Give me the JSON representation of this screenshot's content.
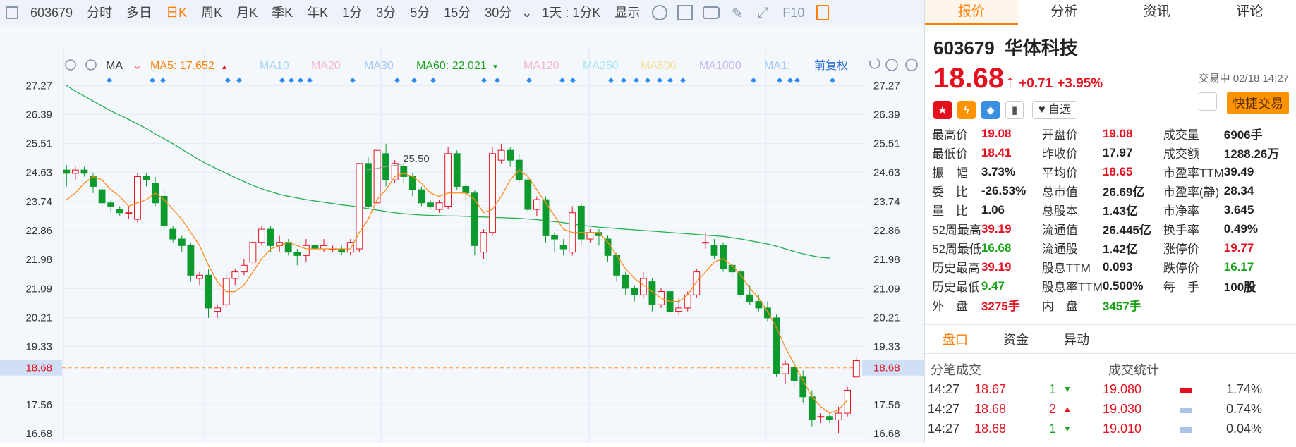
{
  "toolbar": {
    "code": "603679",
    "items": [
      "分时",
      "多日",
      "日K",
      "周K",
      "月K",
      "季K",
      "年K",
      "1分",
      "3分",
      "5分",
      "15分",
      "30分"
    ],
    "active": "日K",
    "range": "1天 : 1分K",
    "display": "显示",
    "f10": "F10"
  },
  "ma_bar": {
    "ma_label": "MA",
    "ma5": "MA5: 17.652",
    "ma10": "MA10",
    "ma20": "MA20",
    "ma30": "MA30",
    "ma60": "MA60: 22.021",
    "ma120": "MA120",
    "ma250": "MA250",
    "ma500": "MA500",
    "ma1000": "MA1000",
    "ma1": "MA1:",
    "adjust": "前复权"
  },
  "axis": {
    "ticks": [
      "27.27",
      "26.39",
      "25.51",
      "24.63",
      "23.74",
      "22.86",
      "21.98",
      "21.09",
      "20.21",
      "19.33",
      "18.68",
      "17.56",
      "16.68"
    ],
    "current": "18.68"
  },
  "annotations": {
    "high": "25.50",
    "low": "16.68"
  },
  "right": {
    "tabs": [
      "报价",
      "分析",
      "资讯",
      "评论"
    ],
    "code": "603679",
    "name": "华体科技",
    "price": "18.68",
    "arrow": "↑",
    "change": "+0.71",
    "pct": "+3.95%",
    "status": "交易中 02/18 14:27",
    "fav": "自选",
    "quick": "快捷交易",
    "quotes": [
      [
        "最高价",
        "19.08",
        "red",
        "开盘价",
        "19.08",
        "red",
        "成交量",
        "6906手",
        "blk"
      ],
      [
        "最低价",
        "18.41",
        "red",
        "昨收价",
        "17.97",
        "blk",
        "成交额",
        "1288.26万",
        "blk"
      ],
      [
        "振　幅",
        "3.73%",
        "blk",
        "平均价",
        "18.65",
        "red",
        "市盈率TTM",
        "39.49",
        "blk"
      ],
      [
        "委　比",
        "-26.53%",
        "blk",
        "总市值",
        "26.69亿",
        "blk",
        "市盈率(静)",
        "28.34",
        "blk"
      ],
      [
        "量　比",
        "1.06",
        "blk",
        "总股本",
        "1.43亿",
        "blk",
        "市净率",
        "3.645",
        "blk"
      ],
      [
        "52周最高",
        "39.19",
        "red",
        "流通值",
        "26.445亿",
        "blk",
        "换手率",
        "0.49%",
        "blk"
      ],
      [
        "52周最低",
        "16.68",
        "grn",
        "流通股",
        "1.42亿",
        "blk",
        "涨停价",
        "19.77",
        "red"
      ],
      [
        "历史最高",
        "39.19",
        "red",
        "股息TTM",
        "0.093",
        "blk",
        "跌停价",
        "16.17",
        "grn"
      ],
      [
        "历史最低",
        "9.47",
        "grn",
        "股息率TTM",
        "0.500%",
        "blk",
        "每　手",
        "100股",
        "blk"
      ],
      [
        "外　盘",
        "3275手",
        "red",
        "内　盘",
        "3457手",
        "grn",
        "",
        "",
        ""
      ]
    ],
    "ptabs": [
      "盘口",
      "资金",
      "异动"
    ],
    "ticks_header": "分笔成交",
    "stats_header": "成交统计",
    "ticks": [
      {
        "t": "14:27",
        "p": "18.67",
        "v": "1",
        "d": "down",
        "sp": "19.080",
        "pct": "1.74%"
      },
      {
        "t": "14:27",
        "p": "18.68",
        "v": "2",
        "d": "up",
        "sp": "19.030",
        "pct": "0.74%"
      },
      {
        "t": "14:27",
        "p": "18.68",
        "v": "1",
        "d": "down",
        "sp": "19.010",
        "pct": "0.04%"
      }
    ]
  },
  "chart_data": {
    "type": "candlestick",
    "ylim": [
      16.4,
      27.6
    ],
    "candles": [
      [
        24.7,
        24.6,
        24.85,
        24.2
      ],
      [
        24.6,
        24.7,
        24.8,
        24.4
      ],
      [
        24.7,
        24.6,
        24.8,
        24.5
      ],
      [
        24.5,
        24.2,
        24.6,
        24.0
      ],
      [
        24.1,
        23.7,
        24.2,
        23.6
      ],
      [
        23.7,
        23.6,
        23.8,
        23.4
      ],
      [
        23.5,
        23.4,
        23.6,
        23.3
      ],
      [
        23.4,
        23.4,
        23.6,
        23.2
      ],
      [
        23.2,
        24.5,
        24.6,
        23.1
      ],
      [
        24.5,
        24.4,
        24.6,
        24.2
      ],
      [
        24.3,
        23.7,
        24.5,
        23.6
      ],
      [
        23.9,
        23.0,
        24.1,
        22.9
      ],
      [
        22.9,
        22.6,
        23.0,
        22.5
      ],
      [
        22.6,
        22.4,
        22.7,
        22.2
      ],
      [
        22.4,
        21.5,
        22.5,
        21.3
      ],
      [
        21.4,
        21.5,
        21.6,
        21.2
      ],
      [
        21.5,
        20.5,
        21.7,
        20.2
      ],
      [
        20.4,
        20.5,
        20.6,
        20.2
      ],
      [
        20.6,
        21.4,
        21.5,
        20.5
      ],
      [
        21.4,
        21.6,
        21.7,
        21.2
      ],
      [
        21.6,
        21.8,
        22.0,
        21.5
      ],
      [
        21.9,
        22.5,
        22.7,
        21.8
      ],
      [
        22.5,
        22.9,
        23.0,
        22.4
      ],
      [
        22.9,
        22.4,
        23.0,
        22.2
      ],
      [
        22.4,
        22.5,
        22.7,
        22.2
      ],
      [
        22.5,
        22.2,
        22.6,
        22.1
      ],
      [
        22.2,
        22.1,
        22.3,
        21.8
      ],
      [
        22.1,
        22.4,
        22.6,
        21.9
      ],
      [
        22.4,
        22.3,
        22.5,
        22.2
      ],
      [
        22.3,
        22.4,
        22.6,
        22.2
      ],
      [
        22.3,
        22.3,
        22.4,
        22.2
      ],
      [
        22.3,
        22.2,
        22.4,
        22.1
      ],
      [
        22.2,
        22.5,
        22.6,
        22.1
      ],
      [
        22.3,
        24.9,
        24.9,
        22.2
      ],
      [
        24.9,
        23.6,
        25.1,
        23.5
      ],
      [
        23.7,
        25.3,
        25.5,
        23.6
      ],
      [
        25.2,
        24.4,
        25.5,
        24.2
      ],
      [
        24.4,
        24.9,
        25.0,
        24.3
      ],
      [
        24.8,
        24.5,
        24.9,
        24.3
      ],
      [
        24.5,
        24.1,
        24.6,
        23.9
      ],
      [
        24.1,
        23.7,
        24.2,
        23.6
      ],
      [
        23.7,
        23.6,
        23.8,
        23.5
      ],
      [
        23.5,
        23.7,
        23.8,
        23.4
      ],
      [
        23.6,
        25.2,
        25.4,
        23.5
      ],
      [
        25.2,
        24.2,
        25.3,
        24.1
      ],
      [
        24.2,
        24.0,
        24.3,
        23.8
      ],
      [
        24.0,
        22.4,
        24.1,
        22.1
      ],
      [
        22.2,
        22.8,
        22.9,
        22.0
      ],
      [
        22.8,
        25.2,
        25.4,
        22.7
      ],
      [
        25.0,
        25.3,
        25.5,
        24.9
      ],
      [
        25.3,
        25.0,
        25.4,
        24.8
      ],
      [
        25.0,
        24.4,
        25.2,
        24.3
      ],
      [
        24.4,
        23.5,
        24.6,
        23.4
      ],
      [
        23.5,
        23.8,
        23.9,
        23.3
      ],
      [
        23.8,
        22.7,
        23.9,
        22.5
      ],
      [
        22.7,
        22.6,
        22.8,
        22.2
      ],
      [
        22.4,
        22.3,
        22.6,
        22.1
      ],
      [
        22.2,
        23.4,
        23.6,
        22.1
      ],
      [
        23.6,
        22.6,
        23.7,
        22.4
      ],
      [
        22.6,
        22.8,
        22.9,
        22.5
      ],
      [
        22.8,
        22.7,
        22.9,
        22.4
      ],
      [
        22.6,
        22.1,
        22.7,
        21.9
      ],
      [
        22.1,
        21.5,
        22.2,
        21.3
      ],
      [
        21.5,
        21.1,
        21.6,
        20.9
      ],
      [
        21.1,
        20.9,
        21.2,
        20.7
      ],
      [
        20.9,
        21.4,
        21.6,
        20.8
      ],
      [
        21.3,
        20.6,
        21.4,
        20.4
      ],
      [
        20.6,
        21.0,
        21.1,
        20.5
      ],
      [
        21.0,
        20.4,
        21.1,
        20.3
      ],
      [
        20.4,
        20.5,
        20.8,
        20.3
      ],
      [
        20.5,
        20.9,
        21.0,
        20.4
      ],
      [
        20.9,
        21.6,
        21.7,
        20.8
      ],
      [
        22.5,
        22.5,
        22.8,
        22.3
      ],
      [
        22.4,
        22.1,
        22.6,
        22.0
      ],
      [
        22.4,
        21.7,
        22.5,
        21.6
      ],
      [
        21.8,
        21.6,
        21.9,
        21.4
      ],
      [
        21.6,
        20.9,
        21.7,
        20.8
      ],
      [
        20.9,
        20.7,
        21.2,
        20.6
      ],
      [
        20.7,
        20.5,
        20.9,
        20.4
      ],
      [
        20.5,
        20.2,
        20.7,
        20.1
      ],
      [
        20.2,
        18.5,
        20.3,
        18.4
      ],
      [
        18.5,
        18.8,
        18.9,
        18.2
      ],
      [
        18.7,
        18.3,
        18.9,
        18.1
      ],
      [
        18.4,
        17.8,
        18.6,
        17.6
      ],
      [
        17.8,
        17.1,
        18.0,
        16.9
      ],
      [
        17.2,
        17.2,
        17.3,
        17.0
      ],
      [
        17.2,
        17.1,
        17.3,
        17.0
      ],
      [
        17.1,
        17.3,
        17.5,
        16.7
      ],
      [
        17.3,
        18.0,
        18.1,
        17.2
      ],
      [
        18.4,
        18.9,
        19.0,
        18.4
      ]
    ],
    "ma5": [
      23.8,
      24.0,
      24.3,
      24.5,
      24.4,
      24.1,
      23.9,
      23.6,
      23.7,
      23.8,
      24.0,
      23.8,
      23.5,
      23.2,
      22.8,
      22.4,
      21.8,
      21.3,
      21.0,
      21.0,
      21.2,
      21.6,
      22.0,
      22.3,
      22.4,
      22.5,
      22.4,
      22.3,
      22.3,
      22.3,
      22.3,
      22.3,
      22.3,
      22.8,
      23.2,
      23.8,
      24.1,
      24.5,
      24.6,
      24.5,
      24.3,
      24.0,
      23.9,
      24.0,
      24.0,
      24.0,
      23.8,
      23.4,
      23.5,
      23.9,
      24.4,
      24.7,
      24.5,
      24.1,
      23.7,
      23.3,
      22.9,
      22.8,
      22.8,
      22.8,
      22.8,
      22.5,
      22.1,
      21.7,
      21.4,
      21.2,
      21.0,
      20.8,
      20.7,
      20.7,
      20.9,
      21.3,
      21.6,
      21.9,
      22.0,
      21.8,
      21.5,
      21.1,
      20.8,
      20.4,
      19.9,
      19.3,
      18.8,
      18.3,
      17.8,
      17.5,
      17.3,
      17.4,
      17.7
    ],
    "ma60": [
      27.27,
      27.1,
      26.95,
      26.8,
      26.65,
      26.5,
      26.37,
      26.24,
      26.1,
      25.96,
      25.8,
      25.65,
      25.5,
      25.33,
      25.17,
      25.0,
      24.86,
      24.73,
      24.6,
      24.47,
      24.35,
      24.23,
      24.13,
      24.04,
      23.96,
      23.9,
      23.85,
      23.8,
      23.76,
      23.72,
      23.68,
      23.64,
      23.61,
      23.57,
      23.52,
      23.48,
      23.44,
      23.4,
      23.37,
      23.35,
      23.33,
      23.32,
      23.31,
      23.3,
      23.3,
      23.29,
      23.28,
      23.27,
      23.26,
      23.25,
      23.24,
      23.23,
      23.21,
      23.19,
      23.16,
      23.13,
      23.1,
      23.06,
      23.02,
      22.99,
      22.96,
      22.94,
      22.92,
      22.9,
      22.88,
      22.86,
      22.84,
      22.82,
      22.8,
      22.78,
      22.76,
      22.74,
      22.72,
      22.7,
      22.68,
      22.64,
      22.6,
      22.55,
      22.5,
      22.45,
      22.38,
      22.3,
      22.22,
      22.15,
      22.09,
      22.04,
      22.02
    ]
  }
}
